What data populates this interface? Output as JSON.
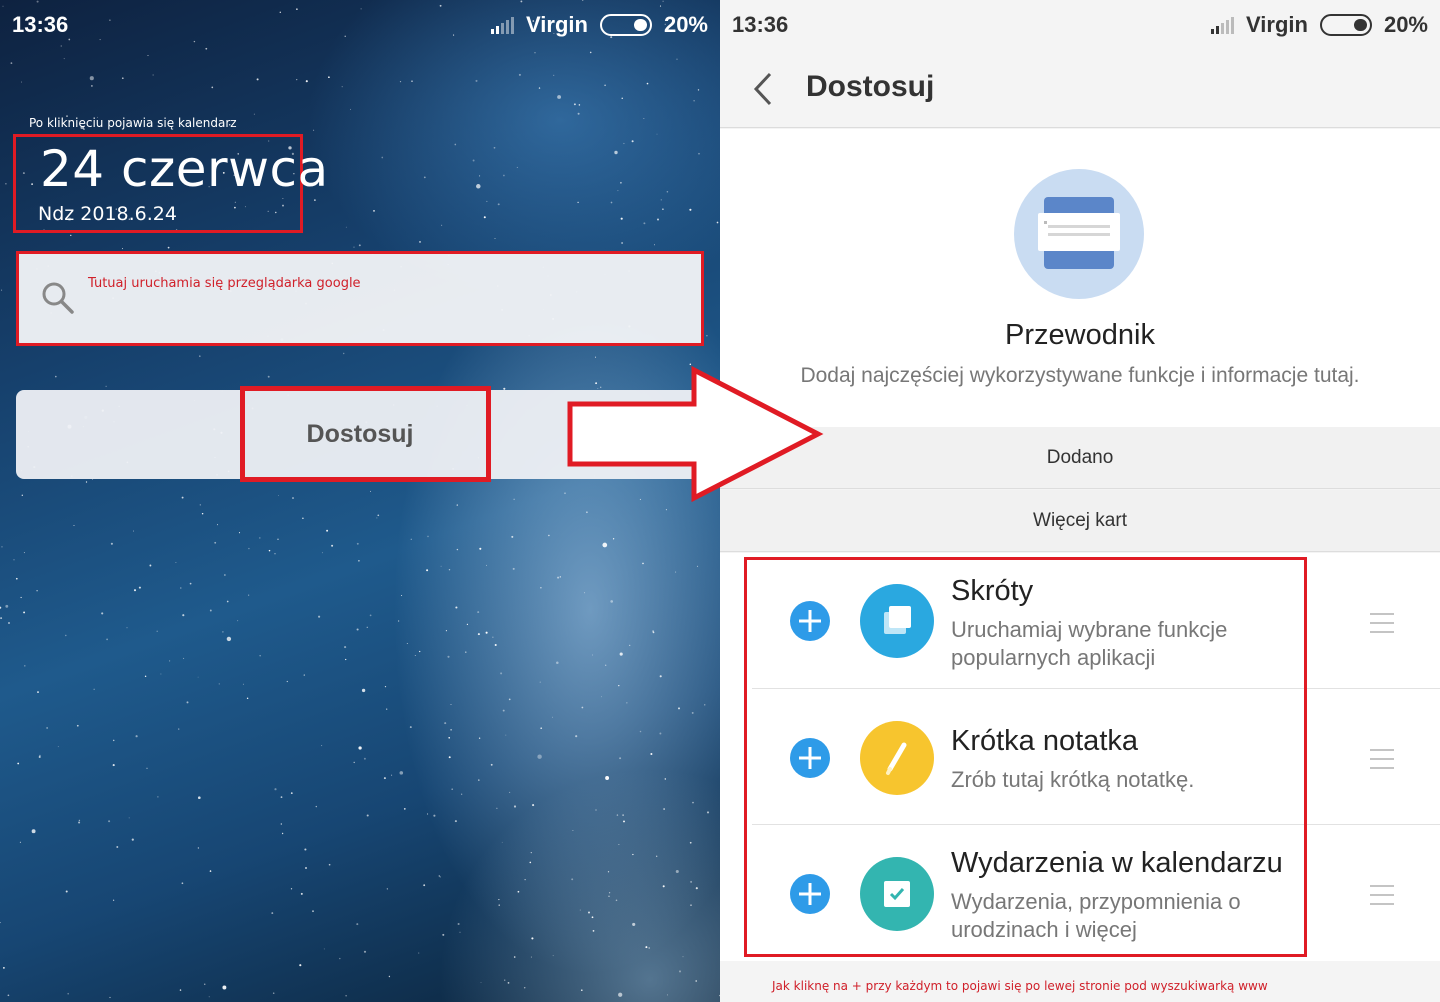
{
  "left_screen": {
    "status_bar": {
      "time": "13:36",
      "carrier": "Virgin",
      "battery": "20%"
    },
    "calendar_annotation": "Po kliknięciu pojawia się kalendarz",
    "date_big": "24 czerwca",
    "date_small": "Ndz 2018.6.24",
    "search": {
      "annotation": "Tutuaj uruchamia się przeglądarka google"
    },
    "customize_button": "Dostosuj"
  },
  "right_screen": {
    "status_bar": {
      "time": "13:36",
      "carrier": "Virgin",
      "battery": "20%"
    },
    "header": {
      "title": "Dostosuj"
    },
    "hero": {
      "title": "Przewodnik",
      "description": "Dodaj najczęściej wykorzystywane funkcje i informacje tutaj."
    },
    "sections": {
      "added": "Dodano",
      "more_cards": "Więcej kart"
    },
    "cards": [
      {
        "title": "Skróty",
        "description": "Uruchamiaj wybrane funkcje popularnych aplikacji",
        "icon": "shortcuts-icon",
        "color": "#2aa8e0"
      },
      {
        "title": "Krótka notatka",
        "description": "Zrób tutaj krótką notatkę.",
        "icon": "pencil-icon",
        "color": "#f7c52e"
      },
      {
        "title": "Wydarzenia w kalendarzu",
        "description": "Wydarzenia, przypomnienia o urodzinach i więcej",
        "icon": "calendar-check-icon",
        "color": "#33b5b0"
      }
    ],
    "bottom_annotation": "Jak kliknę na + przy każdym to pojawi się po lewej stronie pod wyszukiwarką www"
  },
  "colors": {
    "annotation_red": "#e01b24",
    "add_blue": "#2e9be8"
  }
}
